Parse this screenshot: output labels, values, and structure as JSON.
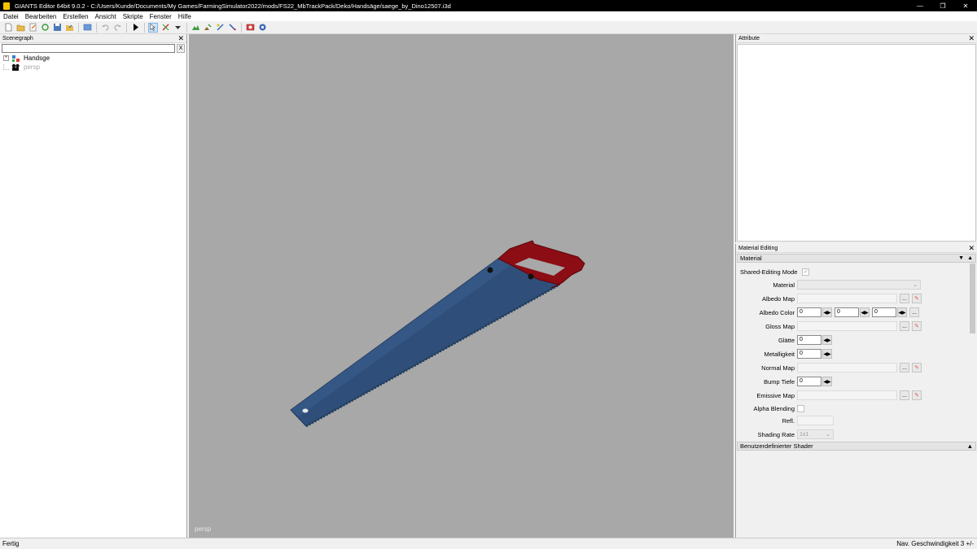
{
  "window": {
    "title": "GIANTS Editor 64bit 9.0.2 - C:/Users/Kunde/Documents/My Games/FarmingSimulator2022/mods/FS22_MbTrackPack/Deko/Handsäge/saege_by_Dino12507.i3d",
    "minimize": "—",
    "restore": "❐",
    "close": "✕"
  },
  "menu": [
    "Datei",
    "Bearbeiten",
    "Erstellen",
    "Ansicht",
    "Skripte",
    "Fenster",
    "Hilfe"
  ],
  "scenegraph": {
    "title": "Scenegraph",
    "close": "✕",
    "clear": "X",
    "expand": "+",
    "nodes": [
      {
        "label": "Handsge",
        "icon": "transform-group-icon"
      },
      {
        "label": "persp",
        "icon": "camera-icon"
      }
    ]
  },
  "viewport": {
    "camera_label": "persp",
    "background": "#a8a8a8",
    "blade_color": "#2f4f7a",
    "handle_color": "#8c0d14"
  },
  "attributes": {
    "title": "Attribute",
    "close": "✕"
  },
  "material_editing": {
    "title": "Material Editing",
    "close": "✕",
    "section": "Material",
    "shared_editing_label": "Shared-Editing Mode",
    "material_label": "Material",
    "albedo_map_label": "Albedo Map",
    "albedo_color_label": "Albedo Color",
    "albedo_color_values": [
      "0",
      "0",
      "0"
    ],
    "gloss_map_label": "Gloss Map",
    "smoothness_label": "Glätte",
    "smoothness_value": "0",
    "metallic_label": "Metalligkeit",
    "metallic_value": "0",
    "normal_map_label": "Normal Map",
    "bump_depth_label": "Bump Tiefe",
    "bump_depth_value": "0",
    "emissive_map_label": "Emissive Map",
    "alpha_blending_label": "Alpha Blending",
    "refl_label": "Refl.",
    "shading_rate_label": "Shading Rate",
    "shading_rate_value": "1x1",
    "browse": "...",
    "custom_shader_section": "Benutzerdefinierter Shader"
  },
  "status": {
    "left": "Fertig",
    "right": "Nav. Geschwindigkeit 3 +/-"
  }
}
